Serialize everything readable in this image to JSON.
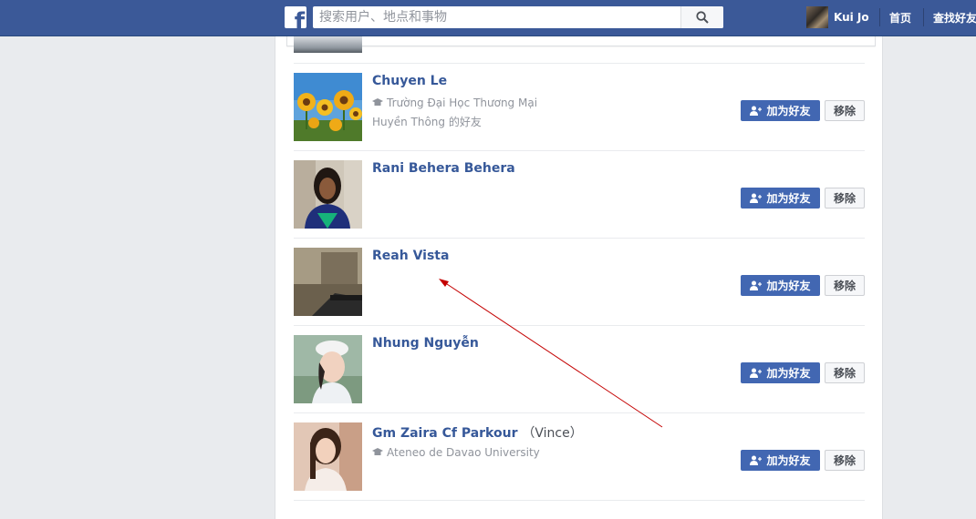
{
  "header": {
    "search": {
      "placeholder": "搜索用户、地点和事物"
    },
    "user": {
      "name": "Kui Jo"
    },
    "nav": {
      "home": "首页",
      "find_friends": "查找好友"
    }
  },
  "suggestions": [
    {
      "name": "Chuyen Le",
      "school": "Trường Đại Học Thương Mại",
      "mutual": "Huyền Thông 的好友",
      "add_label": "加为好友",
      "remove_label": "移除"
    },
    {
      "name": "Rani Behera Behera",
      "add_label": "加为好友",
      "remove_label": "移除"
    },
    {
      "name": "Reah Vista",
      "add_label": "加为好友",
      "remove_label": "移除"
    },
    {
      "name": "Nhung Nguyễn",
      "add_label": "加为好友",
      "remove_label": "移除"
    },
    {
      "name": "Gm Zaira Cf Parkour",
      "nickname": "（Vince）",
      "school": "Ateneo de Davao University",
      "add_label": "加为好友",
      "remove_label": "移除"
    }
  ],
  "colors": {
    "header_bg": "#3b5998",
    "primary_button": "#4267b2",
    "name_link": "#365899",
    "annotation_arrow": "#c40000"
  }
}
